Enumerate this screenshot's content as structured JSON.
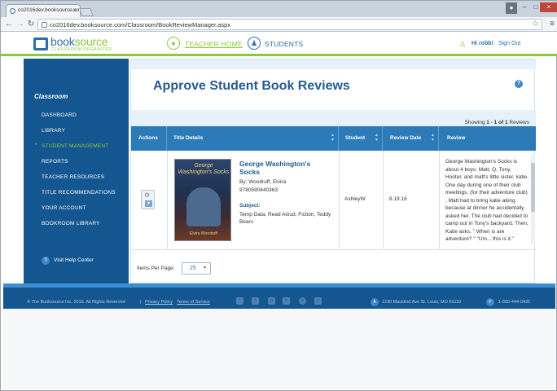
{
  "browser": {
    "tab_title": "co2016dev.booksource.co",
    "url": "co2016dev.booksource.com/Classroom/BookReviewManager.aspx"
  },
  "header": {
    "logo_main_a": "book",
    "logo_main_b": "source",
    "logo_sub": "CLASSROOM ORGANIZER",
    "teacher_home": "TEACHER HOME",
    "students": "STUDENTS",
    "greeting": "Hi robb!",
    "sign_out": "Sign Out"
  },
  "sidebar": {
    "heading": "Classroom",
    "items": [
      {
        "label": "DASHBOARD"
      },
      {
        "label": "LIBRARY"
      },
      {
        "label": "STUDENT MANAGEMENT"
      },
      {
        "label": "REPORTS"
      },
      {
        "label": "TEACHER RESOURCES"
      },
      {
        "label": "TITLE RECOMMENDATIONS"
      },
      {
        "label": "YOUR ACCOUNT"
      },
      {
        "label": "BOOKROOM LIBRARY"
      }
    ],
    "active_item": "STUDENT MANAGEMENT",
    "help": "Visit Help Center"
  },
  "main": {
    "title": "Approve Student Book Reviews",
    "showing_prefix": "Showing ",
    "showing_range": "1 - 1 of 1",
    "showing_suffix": " Reviews",
    "columns": {
      "actions": "Actions",
      "title_details": "Title Details",
      "student": "Student",
      "review_date": "Review Date",
      "review": "Review"
    },
    "row": {
      "book_title": "George Washington's Socks",
      "by": "By: Woodruff, Elvira",
      "isbn": "9780590440363",
      "subject_label": "Subject:",
      "subjects": "Temp Data, Read Aloud, Fiction, Teddy Bears",
      "cover_title": "George Washington's Socks",
      "cover_author": "Elvira Woodruff",
      "student": "AshleyW",
      "review_date": "8.19.16",
      "review_text": "George Washington's Socks is about 4 boys: Matt, Q, Tony, Hooter, and matt's little sister, katie. One day during one of their club meetings, (for their adventure club) , Matt had to bring katie along because at dinner he accidentally asked her. The club had decided to camp out in Tony's backyard. Then, Katie asks, \" When is are adventure? \" \"Um... this is it.\""
    },
    "items_per_page_label": "Items Per Page:",
    "items_per_page_value": "25"
  },
  "footer": {
    "copyright": "© The Booksource Inc. 2016. All Rights Reserved",
    "privacy": "Privacy Policy",
    "terms": "Terms of Service",
    "address": "1230 Macklind Ave St. Louis, MO 63110",
    "phone": "1-800-444-0435"
  },
  "colors": {
    "brand_blue": "#14568f",
    "brand_green": "#8dc63f",
    "table_header": "#2d7ab8"
  },
  "icons": [
    "gear-icon",
    "caret-down-icon",
    "apple-icon",
    "students-icon",
    "person-icon",
    "help-icon",
    "facebook-icon",
    "twitter-icon",
    "pinterest-icon",
    "linkedin-icon",
    "wordpress-icon",
    "instagram-icon",
    "location-icon",
    "phone-icon"
  ]
}
